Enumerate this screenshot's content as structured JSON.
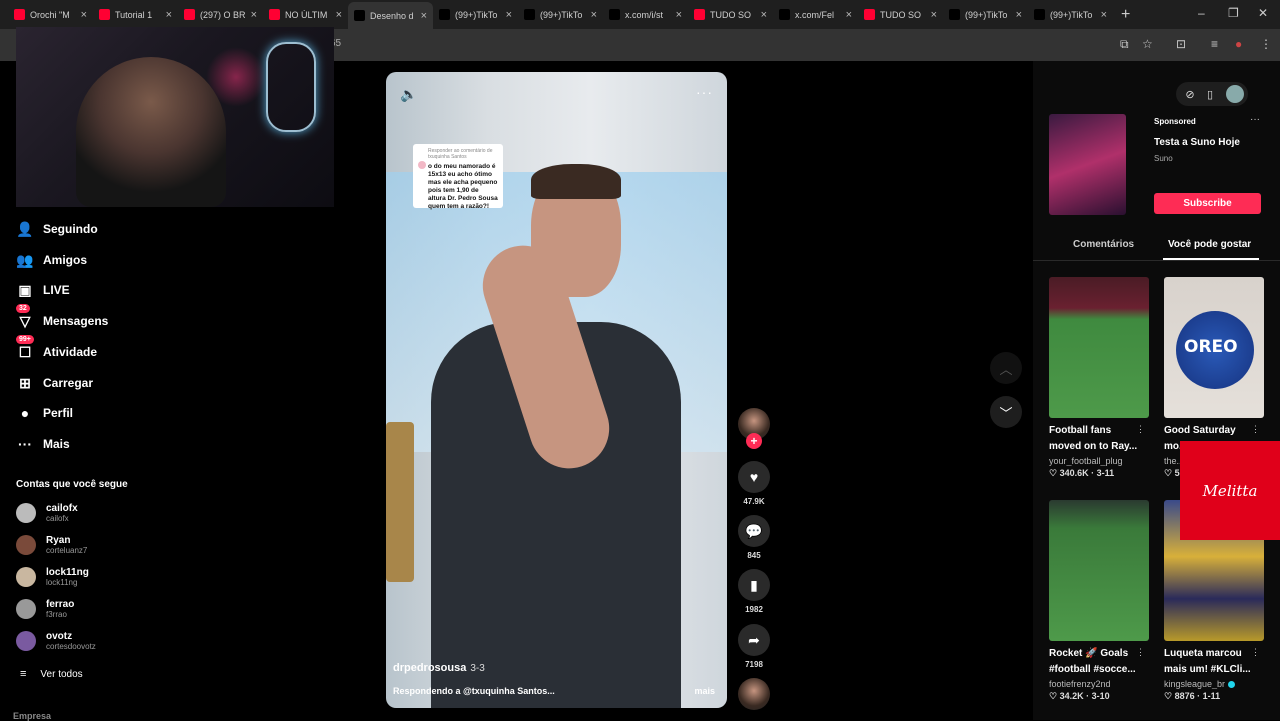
{
  "browser": {
    "tabs": [
      {
        "label": "Orochi \"M",
        "color": "#ff0033"
      },
      {
        "label": "Tutorial 1",
        "color": "#ff0033"
      },
      {
        "label": "(297) O BR",
        "color": "#ff0033"
      },
      {
        "label": "NO ÚLTIM",
        "color": "#ff0033"
      },
      {
        "label": "Desenho d",
        "color": "#000000",
        "active": true
      },
      {
        "label": "(99+)TikTo",
        "color": "#000000"
      },
      {
        "label": "(99+)TikTo",
        "color": "#000000"
      },
      {
        "label": "x.com/i/st",
        "color": "#000000"
      },
      {
        "label": "TUDO SO",
        "color": "#ff0033"
      },
      {
        "label": "x.com/Fel",
        "color": "#000000"
      },
      {
        "label": "TUDO SO",
        "color": "#ff0033"
      },
      {
        "label": "(99+)TikTo",
        "color": "#000000"
      },
      {
        "label": "(99+)TikTo",
        "color": "#000000"
      }
    ],
    "url_fragment": "65",
    "new_tab_glyph": "+",
    "minimize_glyph": "–",
    "maximize_glyph": "❐",
    "close_glyph": "✕"
  },
  "sidebar": {
    "nav": [
      {
        "label": "Seguindo",
        "icon": "following-icon",
        "glyph": "👤"
      },
      {
        "label": "Amigos",
        "icon": "friends-icon",
        "glyph": "👥"
      },
      {
        "label": "LIVE",
        "icon": "live-icon",
        "glyph": "▣"
      },
      {
        "label": "Mensagens",
        "icon": "messages-icon",
        "glyph": "▽",
        "badge": "32"
      },
      {
        "label": "Atividade",
        "icon": "activity-icon",
        "glyph": "☐",
        "badge": "99+"
      },
      {
        "label": "Carregar",
        "icon": "upload-icon",
        "glyph": "⊞"
      },
      {
        "label": "Perfil",
        "icon": "profile-icon",
        "glyph": "●"
      },
      {
        "label": "Mais",
        "icon": "more-icon",
        "glyph": "···"
      }
    ],
    "following_title": "Contas que você segue",
    "accounts": [
      {
        "name": "cailofx",
        "handle": "cailofx",
        "color": "#bbbbbb"
      },
      {
        "name": "Ryan",
        "handle": "corteluanz7",
        "color": "#7a4a3a"
      },
      {
        "name": "lock11ng",
        "handle": "lock11ng",
        "color": "#c9b7a0"
      },
      {
        "name": "ferrao",
        "handle": "f3rrao",
        "color": "#999999"
      },
      {
        "name": "ovotz",
        "handle": "cortesdoovotz",
        "color": "#7a5aa0"
      }
    ],
    "see_all": "Ver todos",
    "bottom_cut": "Empresa"
  },
  "video": {
    "comment_reply_to": "Responder ao comentário de txuquinha Santos",
    "comment_text": "o do meu namorado é 15x13 eu acho ótimo mas ele acha pequeno pois tem 1,90 de altura Dr. Pedro Sousa quem tem a razão?!",
    "author": "drpedrosousa",
    "date": "3-3",
    "description": "Respondendo a @txuquinha Santos...",
    "more": "mais",
    "likes": "47.9K",
    "comments": "845",
    "saves": "1982",
    "shares": "7198"
  },
  "right_panel": {
    "ad": {
      "sponsored": "Sponsored",
      "title": "Testa a Suno Hoje",
      "advertiser": "Suno",
      "cta": "Subscribe"
    },
    "tabs": [
      "Comentários",
      "Você pode gostar"
    ],
    "cards": [
      {
        "title1": "Football fans",
        "title2": "moved on to Ray...",
        "author": "your_football_plug",
        "likes": "340.6K",
        "date": "3-11"
      },
      {
        "title1": "Good Saturday",
        "title2": "mo...",
        "author": "the...",
        "likes": "5",
        "date": ""
      },
      {
        "title1": "Rocket 🚀 Goals",
        "title2": "#football #socce...",
        "author": "footiefrenzy2nd",
        "likes": "34.2K",
        "date": "3-10"
      },
      {
        "title1": "Luqueta marcou",
        "title2": "mais um! #KLCli...",
        "author": "kingsleague_br",
        "likes": "8876",
        "date": "1-11",
        "verified": true
      }
    ],
    "oreo_text": "OREO",
    "overlay_logo": "Melitta"
  },
  "colors": {
    "accent": "#fe2c55",
    "overlay_red": "#e0001a"
  }
}
